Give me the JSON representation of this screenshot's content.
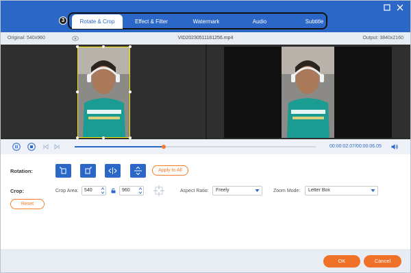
{
  "tabs": {
    "step_badge": "3",
    "items": [
      {
        "label": "Rotate & Crop",
        "active": true
      },
      {
        "label": "Effect & Filter",
        "active": false
      },
      {
        "label": "Watermark",
        "active": false
      },
      {
        "label": "Audio",
        "active": false
      },
      {
        "label": "Subtitle",
        "active": false
      }
    ]
  },
  "window": {
    "maximize_icon": "square-icon",
    "close_icon": "close-icon"
  },
  "info": {
    "original": "Original: 540x960",
    "filename": "VID20230511181256.mp4",
    "output": "Output: 3840x2160"
  },
  "playback": {
    "time": "00:00:02.07/00:00:06.05",
    "progress": 0.37
  },
  "rotation": {
    "label": "Rotation:",
    "buttons": [
      "rotate-left",
      "rotate-right",
      "flip-horizontal",
      "flip-vertical"
    ],
    "apply_all": "Apply to All"
  },
  "crop": {
    "label": "Crop:",
    "area_label": "Crop Area:",
    "width": "540",
    "height": "960",
    "aspect_label": "Aspect Ratio:",
    "aspect_value": "Freely",
    "zoom_label": "Zoom Mode:",
    "zoom_value": "Letter Box",
    "reset": "Reset"
  },
  "footer": {
    "ok": "OK",
    "cancel": "Cancel"
  },
  "colors": {
    "accent": "#2b67c6",
    "orange": "#f07228",
    "crop_box": "#ffe600"
  }
}
